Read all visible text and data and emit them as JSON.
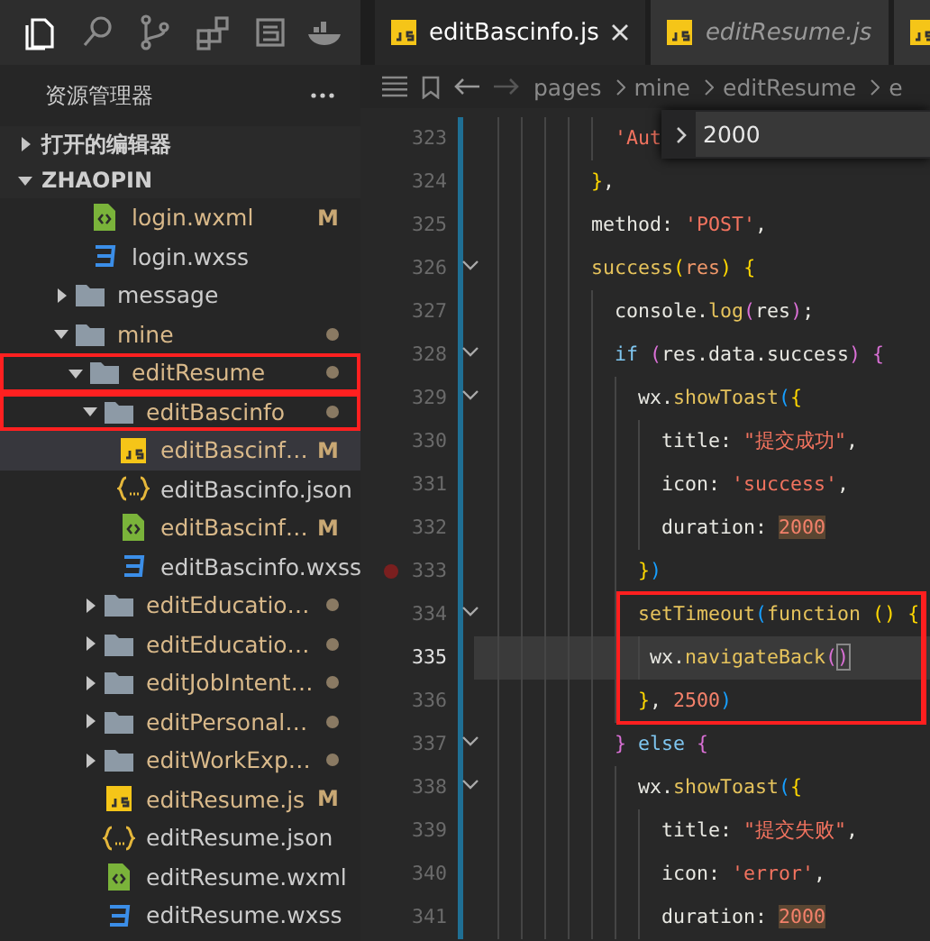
{
  "activity_bar": [
    {
      "kind": "explorer",
      "selected": true
    },
    {
      "kind": "search",
      "selected": false
    },
    {
      "kind": "branch",
      "selected": false
    },
    {
      "kind": "extensions",
      "selected": false
    },
    {
      "kind": "panel",
      "selected": false
    },
    {
      "kind": "whale",
      "selected": false
    }
  ],
  "explorer": {
    "title": "资源管理器",
    "sections": [
      {
        "label": "打开的编辑器",
        "expanded": false
      },
      {
        "label": "ZHAOPIN",
        "expanded": true
      }
    ],
    "tree_cut_children": [
      {
        "name": "login.wxml",
        "kind": "wxml",
        "status": "M",
        "modified": true,
        "selected": false,
        "boxed": false
      },
      {
        "name": "login.wxss",
        "kind": "wxss",
        "modified": false,
        "selected": false,
        "boxed": false
      }
    ],
    "tree": [
      {
        "name": "message",
        "kind": "folder",
        "expanded": false,
        "modified": false,
        "selected": false,
        "boxed": false
      },
      {
        "name": "mine",
        "kind": "folder",
        "expanded": true,
        "modified": true,
        "selected": false,
        "boxed": false,
        "children": [
          {
            "name": "editResume",
            "kind": "folder",
            "expanded": true,
            "modified": true,
            "selected": false,
            "boxed": true,
            "children": [
              {
                "name": "editBascinfo",
                "kind": "folder",
                "expanded": true,
                "modified": true,
                "selected": false,
                "boxed": true,
                "children": [
                  {
                    "name": "editBascinf…",
                    "kind": "js",
                    "status": "M",
                    "modified": true,
                    "selected": true,
                    "boxed": false
                  },
                  {
                    "name": "editBascinfo.json",
                    "kind": "json",
                    "modified": false,
                    "selected": false,
                    "boxed": false
                  },
                  {
                    "name": "editBascinf…",
                    "kind": "wxml",
                    "status": "M",
                    "modified": true,
                    "selected": false,
                    "boxed": false
                  },
                  {
                    "name": "editBascinfo.wxss",
                    "kind": "wxss",
                    "modified": false,
                    "selected": false,
                    "boxed": false
                  }
                ]
              },
              {
                "name": "editEducatio…",
                "kind": "folder",
                "expanded": false,
                "modified": true,
                "selected": false,
                "boxed": false
              },
              {
                "name": "editEducatio…",
                "kind": "folder",
                "expanded": false,
                "modified": true,
                "selected": false,
                "boxed": false
              },
              {
                "name": "editJobIntent…",
                "kind": "folder",
                "expanded": false,
                "modified": true,
                "selected": false,
                "boxed": false
              },
              {
                "name": "editPersonal…",
                "kind": "folder",
                "expanded": false,
                "modified": true,
                "selected": false,
                "boxed": false
              },
              {
                "name": "editWorkExp…",
                "kind": "folder",
                "expanded": false,
                "modified": true,
                "selected": false,
                "boxed": false
              },
              {
                "name": "editResume.js",
                "kind": "js",
                "status": "M",
                "modified": true,
                "selected": false,
                "boxed": false
              },
              {
                "name": "editResume.json",
                "kind": "json",
                "modified": false,
                "selected": false,
                "boxed": false
              },
              {
                "name": "editResume.wxml",
                "kind": "wxml",
                "modified": false,
                "selected": false,
                "boxed": false
              },
              {
                "name": "editResume.wxss",
                "kind": "wxss",
                "modified": false,
                "selected": false,
                "boxed": false
              }
            ]
          }
        ]
      }
    ]
  },
  "tabs": [
    {
      "label": "editBascinfo.js",
      "kind": "js",
      "selected": true,
      "preview": false
    },
    {
      "label": "editResume.js",
      "kind": "js",
      "selected": false,
      "preview": true
    },
    {
      "kind": "js",
      "selected": false,
      "preview": false
    }
  ],
  "breadcrumbs": [
    "pages",
    "mine",
    "editResume",
    "e"
  ],
  "goto_widget": {
    "value": "2000"
  },
  "editor": {
    "lines": [
      {
        "num": "323",
        "fold": false,
        "breakpoint": false,
        "current": false,
        "boxed": false,
        "tokens": [
          {
            "text": "            'Aut",
            "kind": "string"
          }
        ]
      },
      {
        "num": "324",
        "fold": false,
        "breakpoint": false,
        "current": false,
        "boxed": false,
        "tokens": [
          {
            "text": "          }",
            "kind": "b1"
          },
          {
            "text": ",",
            "kind": "plain"
          }
        ]
      },
      {
        "num": "325",
        "fold": false,
        "breakpoint": false,
        "current": false,
        "boxed": false,
        "tokens": [
          {
            "text": "          method: ",
            "kind": "plain"
          },
          {
            "text": "'POST'",
            "kind": "string"
          },
          {
            "text": ",",
            "kind": "plain"
          }
        ]
      },
      {
        "num": "326",
        "fold": true,
        "breakpoint": false,
        "current": false,
        "boxed": false,
        "tokens": [
          {
            "text": "          success",
            "kind": "func"
          },
          {
            "text": "(",
            "kind": "b1"
          },
          {
            "text": "res",
            "kind": "param"
          },
          {
            "text": ")",
            "kind": "b1"
          },
          {
            "text": " {",
            "kind": "b1"
          }
        ]
      },
      {
        "num": "327",
        "fold": false,
        "breakpoint": false,
        "current": false,
        "boxed": false,
        "tokens": [
          {
            "text": "            console.",
            "kind": "plain"
          },
          {
            "text": "log",
            "kind": "func"
          },
          {
            "text": "(",
            "kind": "b2"
          },
          {
            "text": "res",
            "kind": "plain"
          },
          {
            "text": ")",
            "kind": "b2"
          },
          {
            "text": ";",
            "kind": "plain"
          }
        ]
      },
      {
        "num": "328",
        "fold": true,
        "breakpoint": false,
        "current": false,
        "boxed": false,
        "tokens": [
          {
            "text": "            if ",
            "kind": "keyword"
          },
          {
            "text": "(",
            "kind": "b2"
          },
          {
            "text": "res.data.success",
            "kind": "plain"
          },
          {
            "text": ") {",
            "kind": "b2"
          }
        ]
      },
      {
        "num": "329",
        "fold": true,
        "breakpoint": false,
        "current": false,
        "boxed": false,
        "tokens": [
          {
            "text": "              wx.",
            "kind": "plain"
          },
          {
            "text": "showToast",
            "kind": "func"
          },
          {
            "text": "(",
            "kind": "b3"
          },
          {
            "text": "{",
            "kind": "b1"
          }
        ]
      },
      {
        "num": "330",
        "fold": false,
        "breakpoint": false,
        "current": false,
        "boxed": false,
        "tokens": [
          {
            "text": "                title: ",
            "kind": "plain"
          },
          {
            "text": "\"提交成功\"",
            "kind": "string"
          },
          {
            "text": ",",
            "kind": "plain"
          }
        ]
      },
      {
        "num": "331",
        "fold": false,
        "breakpoint": false,
        "current": false,
        "boxed": false,
        "tokens": [
          {
            "text": "                icon: ",
            "kind": "plain"
          },
          {
            "text": "'success'",
            "kind": "string"
          },
          {
            "text": ",",
            "kind": "plain"
          }
        ]
      },
      {
        "num": "332",
        "fold": false,
        "breakpoint": false,
        "current": false,
        "boxed": false,
        "tokens": [
          {
            "text": "                duration: ",
            "kind": "plain"
          },
          {
            "text": "2000",
            "kind": "match"
          }
        ]
      },
      {
        "num": "333",
        "fold": false,
        "breakpoint": true,
        "current": false,
        "boxed": false,
        "tokens": [
          {
            "text": "              }",
            "kind": "b1"
          },
          {
            "text": ")",
            "kind": "b3"
          }
        ]
      },
      {
        "num": "334",
        "fold": true,
        "breakpoint": false,
        "current": false,
        "boxed": true,
        "tokens": [
          {
            "text": "              setTimeout",
            "kind": "func"
          },
          {
            "text": "(",
            "kind": "b3"
          },
          {
            "text": "function ",
            "kind": "func"
          },
          {
            "text": "()",
            "kind": "b1"
          },
          {
            "text": " {",
            "kind": "b1"
          }
        ]
      },
      {
        "num": "335",
        "fold": false,
        "breakpoint": false,
        "current": true,
        "boxed": true,
        "tokens": [
          {
            "text": "               wx.",
            "kind": "plain"
          },
          {
            "text": "navigateBack",
            "kind": "func"
          },
          {
            "text": "(",
            "kind": "b2"
          },
          {
            "text": ")",
            "kind": "bracket-match"
          }
        ]
      },
      {
        "num": "336",
        "fold": false,
        "breakpoint": false,
        "current": false,
        "boxed": true,
        "tokens": [
          {
            "text": "              }",
            "kind": "b1"
          },
          {
            "text": ", ",
            "kind": "plain"
          },
          {
            "text": "2500",
            "kind": "number"
          },
          {
            "text": ")",
            "kind": "b3"
          }
        ]
      },
      {
        "num": "337",
        "fold": true,
        "breakpoint": false,
        "current": false,
        "boxed": false,
        "tokens": [
          {
            "text": "            }",
            "kind": "b2"
          },
          {
            "text": " else ",
            "kind": "keyword"
          },
          {
            "text": "{",
            "kind": "b2"
          }
        ]
      },
      {
        "num": "338",
        "fold": true,
        "breakpoint": false,
        "current": false,
        "boxed": false,
        "tokens": [
          {
            "text": "              wx.",
            "kind": "plain"
          },
          {
            "text": "showToast",
            "kind": "func"
          },
          {
            "text": "(",
            "kind": "b3"
          },
          {
            "text": "{",
            "kind": "b1"
          }
        ]
      },
      {
        "num": "339",
        "fold": false,
        "breakpoint": false,
        "current": false,
        "boxed": false,
        "tokens": [
          {
            "text": "                title: ",
            "kind": "plain"
          },
          {
            "text": "\"提交失败\"",
            "kind": "string"
          },
          {
            "text": ",",
            "kind": "plain"
          }
        ]
      },
      {
        "num": "340",
        "fold": false,
        "breakpoint": false,
        "current": false,
        "boxed": false,
        "tokens": [
          {
            "text": "                icon: ",
            "kind": "plain"
          },
          {
            "text": "'error'",
            "kind": "string"
          },
          {
            "text": ",",
            "kind": "plain"
          }
        ]
      },
      {
        "num": "341",
        "fold": false,
        "breakpoint": false,
        "current": false,
        "boxed": false,
        "tokens": [
          {
            "text": "                duration: ",
            "kind": "plain"
          },
          {
            "text": "2000",
            "kind": "match"
          }
        ]
      }
    ]
  }
}
